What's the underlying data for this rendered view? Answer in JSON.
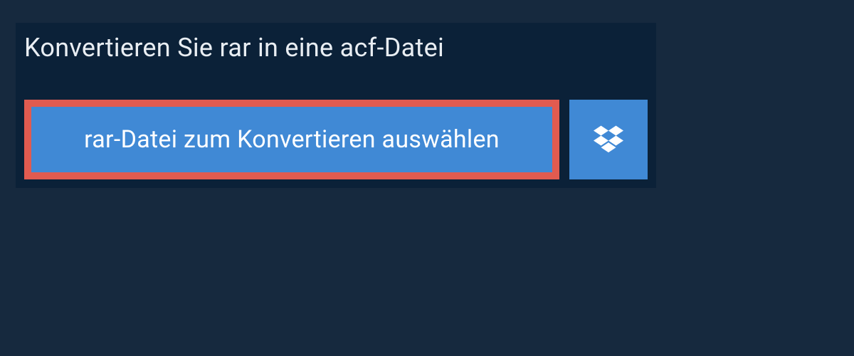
{
  "header": {
    "title": "Konvertieren Sie rar in eine acf-Datei"
  },
  "upload": {
    "select_label": "rar-Datei zum Konvertieren auswählen"
  }
}
